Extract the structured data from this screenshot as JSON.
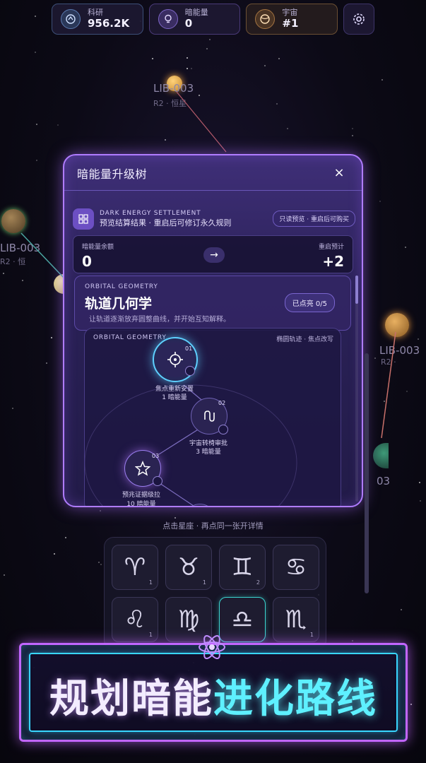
{
  "top_bar": {
    "stats": [
      {
        "label": "科研",
        "value": "956.2K",
        "icon": "research-icon"
      },
      {
        "label": "暗能量",
        "value": "0",
        "icon": "lightbulb-icon"
      },
      {
        "label": "宇宙",
        "value": "#1",
        "icon": "globe-icon"
      }
    ],
    "settings_icon": "gear-icon"
  },
  "background": {
    "planets": [
      {
        "name": "LIB-003",
        "sub": "R2 · 恒星"
      },
      {
        "name": "LIB-003",
        "sub": "R2 · 恒"
      },
      {
        "name": "LIB-003",
        "sub": "R2 ·"
      },
      {
        "name": "03"
      }
    ]
  },
  "modal": {
    "title": "暗能量升级树",
    "close": "×",
    "settlement": {
      "en": "DARK ENERGY SETTLEMENT",
      "cn": "预览结算结果 · 重启后可修订永久规则",
      "badge": "只读预览 · 重启后可购买"
    },
    "balance": {
      "label": "暗能量余额",
      "value": "0",
      "arrow": "→",
      "reset_label": "重启预计",
      "reset_value": "+2"
    },
    "section": {
      "en": "ORBITAL GEOMETRY",
      "title": "轨道几何学",
      "desc": "让轨道逐渐放弃圆整曲线，并开始互知解释。",
      "badge": "已点亮 0/5"
    },
    "tree": {
      "en": "ORBITAL GEOMETRY",
      "right": "椭圆轨迹 · 焦点改写",
      "nodes": [
        {
          "num": "01",
          "name": "焦点重新安置",
          "cost": "1 暗能量"
        },
        {
          "num": "02",
          "name": "宇宙转椅审批",
          "cost": "3 暗能量"
        },
        {
          "num": "03",
          "name": "预兆证据级拉",
          "cost": "10 暗能量"
        }
      ]
    }
  },
  "hint": "点击星座 · 再点同一张开详情",
  "zodiac": [
    {
      "symbol": "♈",
      "count": "1"
    },
    {
      "symbol": "♉",
      "count": "1"
    },
    {
      "symbol": "♊",
      "count": "2"
    },
    {
      "symbol": "♋",
      "count": ""
    },
    {
      "symbol": "♌",
      "count": "1"
    },
    {
      "symbol": "♍",
      "count": ""
    },
    {
      "symbol": "♎",
      "count": ""
    },
    {
      "symbol": "♏",
      "count": "1"
    }
  ],
  "banner": {
    "part1": "规划暗能",
    "part2": "进化路线"
  },
  "colors": {
    "accent_purple": "#b07cff",
    "accent_cyan": "#39d6ff",
    "background": "#0c0a16"
  }
}
